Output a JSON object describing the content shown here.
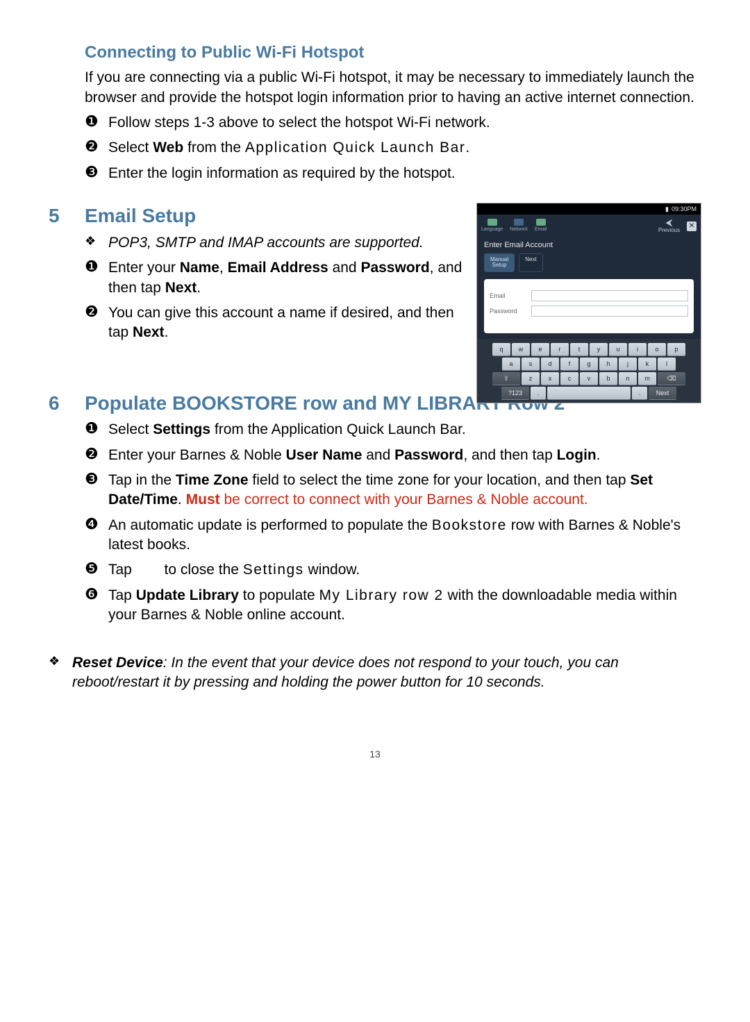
{
  "page_number": "13",
  "section_wifi": {
    "heading": "Connecting to Public Wi-Fi Hotspot",
    "intro": "If you are connecting via a public Wi-Fi hotspot, it may be necessary to immediately launch the browser and provide the hotspot login information prior to having an active internet connection.",
    "step1": "Follow steps 1-3 above to select the hotspot Wi-Fi network.",
    "step2_pre": "Select ",
    "step2_bold": "Web",
    "step2_mid": " from the ",
    "step2_spaced": "Application Quick Launch Bar",
    "step2_post": ".",
    "step3": "Enter the login information as required by the hotspot."
  },
  "section_email": {
    "num": "5",
    "heading": "Email Setup",
    "note": "POP3, SMTP and IMAP accounts are supported.",
    "step1_a": "Enter your ",
    "step1_b1": "Name",
    "step1_c": ", ",
    "step1_b2": "Email Address",
    "step1_d": " and ",
    "step1_b3": "Password",
    "step1_e": ", and then tap ",
    "step1_b4": "Next",
    "step1_f": ".",
    "step2_a": "You can give this account a name if desired, and then tap ",
    "step2_b": "Next",
    "step2_c": "."
  },
  "shot": {
    "time": "09:30PM",
    "tb_lang": "Language",
    "tb_net": "Network",
    "tb_email": "Email",
    "prev": "Previous",
    "title": "Enter Email Account",
    "tab1_l1": "Manual",
    "tab1_l2": "Setup",
    "tab2": "Next",
    "label_email": "Email",
    "label_pwd": "Password",
    "kbd": {
      "r1": [
        "q",
        "w",
        "e",
        "r",
        "t",
        "y",
        "u",
        "i",
        "o",
        "p"
      ],
      "r2": [
        "a",
        "s",
        "d",
        "f",
        "g",
        "h",
        "j",
        "k",
        "l"
      ],
      "r3_shift": "⇧",
      "r3": [
        "z",
        "x",
        "c",
        "v",
        "b",
        "n",
        "m"
      ],
      "r3_del": "⌫",
      "r4_num": "?123",
      "r4_dot": ".",
      "r4_done": "Next"
    }
  },
  "section_book": {
    "num": "6",
    "heading": "Populate BOOKSTORE row and MY LIBRARY Row 2",
    "step1_a": "Select ",
    "step1_b": "Settings",
    "step1_c": " from the Application Quick Launch Bar.",
    "step2_a": "Enter your Barnes & Noble ",
    "step2_b1": "User Name",
    "step2_c": " and ",
    "step2_b2": "Password",
    "step2_d": ", and then tap ",
    "step2_b3": "Login",
    "step2_e": ".",
    "step3_a": "Tap in the ",
    "step3_b1": "Time Zone",
    "step3_c": " field to select the time zone for your location, and then tap ",
    "step3_b2": "Set Date/Time",
    "step3_d": ". ",
    "step3_red_b": "Must",
    "step3_red_rest": " be correct to connect with your Barnes & Noble account.",
    "step4_a": "An automatic update is performed to populate the ",
    "step4_sp": "Bookstore",
    "step4_b": " row with Barnes & Noble's latest books.",
    "step5_a": "Tap ",
    "step5_gap": "      ",
    "step5_b": " to close the ",
    "step5_sp": "Settings",
    "step5_c": " window.",
    "step6_a": "Tap ",
    "step6_b": "Update Library",
    "step6_c": " to populate ",
    "step6_sp": "My Library row 2",
    "step6_d": " with the downloadable media within your Barnes & Noble online account."
  },
  "reset": {
    "bold": "Reset Device",
    "text": ": In the event that your device does not respond to your touch, you can reboot/restart it by pressing and holding the power button for 10 seconds."
  },
  "bullets": {
    "diamond": "❖",
    "c1": "❶",
    "c2": "❷",
    "c3": "❸",
    "c4": "❹",
    "c5": "❺",
    "c6": "❻"
  }
}
